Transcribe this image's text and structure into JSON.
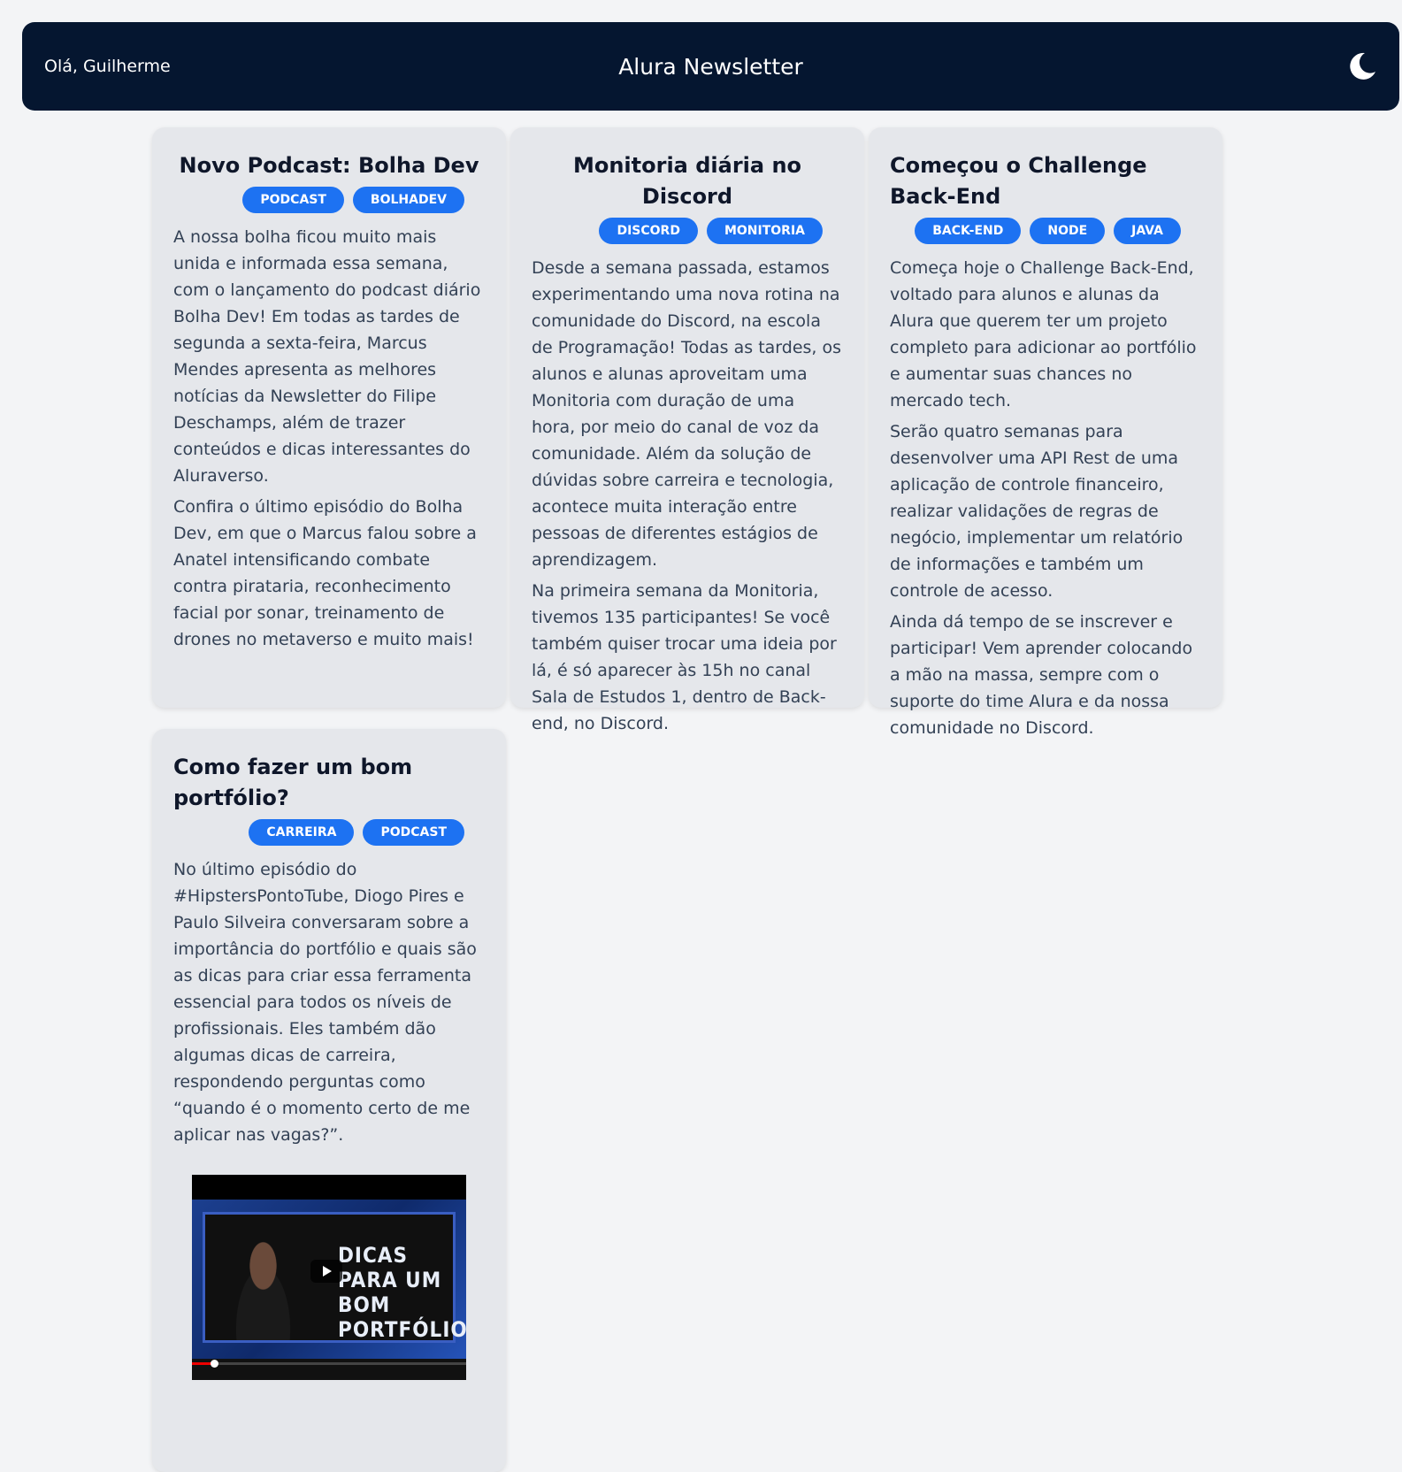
{
  "header": {
    "greeting": "Olá, Guilherme",
    "title": "Alura Newsletter",
    "theme_icon": "moon-icon"
  },
  "posts": [
    {
      "title": "Novo Podcast: Bolha Dev",
      "tags": [
        "PODCAST",
        "BOLHADEV"
      ],
      "paragraphs": [
        "A nossa bolha ficou muito mais unida e informada essa semana, com o lançamento do podcast diário Bolha Dev! Em todas as tardes de segunda a sexta-feira, Marcus Mendes apresenta as melhores notícias da Newsletter do Filipe Deschamps, além de trazer conteúdos e dicas interessantes do Aluraverso.",
        "Confira o último episódio do Bolha Dev, em que o Marcus falou sobre a Anatel intensificando combate contra pirataria, reconhecimento facial por sonar, treinamento de drones no metaverso e muito mais!"
      ]
    },
    {
      "title": "Monitoria diária no Discord",
      "tags": [
        "DISCORD",
        "MONITORIA"
      ],
      "paragraphs": [
        "Desde a semana passada, estamos experimentando uma nova rotina na comunidade do Discord, na escola de Programação! Todas as tardes, os alunos e alunas aproveitam uma Monitoria com duração de uma hora, por meio do canal de voz da comunidade. Além da solução de dúvidas sobre carreira e tecnologia, acontece muita interação entre pessoas de diferentes estágios de aprendizagem.",
        "Na primeira semana da Monitoria, tivemos 135 participantes! Se você também quiser trocar uma ideia por lá, é só aparecer às 15h no canal Sala de Estudos 1, dentro de Back-end, no Discord."
      ]
    },
    {
      "title": "Começou o Challenge Back-End",
      "tags": [
        "BACK-END",
        "NODE",
        "JAVA"
      ],
      "paragraphs": [
        "Começa hoje o Challenge Back-End, voltado para alunos e alunas da Alura que querem ter um projeto completo para adicionar ao portfólio e aumentar suas chances no mercado tech.",
        "Serão quatro semanas para desenvolver uma API Rest de uma aplicação de controle financeiro, realizar validações de regras de negócio, implementar um relatório de informações e também um controle de acesso.",
        "Ainda dá tempo de se inscrever e participar! Vem aprender colocando a mão na massa, sempre com o suporte do time Alura e da nossa comunidade no Discord."
      ]
    },
    {
      "title": "Como fazer um bom portfólio?",
      "tags": [
        "CARREIRA",
        "PODCAST"
      ],
      "paragraphs": [
        "No último episódio do #HipstersPontoTube, Diogo Pires e Paulo Silveira conversaram sobre a importância do portfólio e quais são as dicas para criar essa ferramenta essencial para todos os níveis de profissionais. Eles também dão algumas dicas de carreira, respondendo perguntas como “quando é o momento certo de me aplicar nas vagas?”."
      ],
      "video": {
        "thumbnail_text": "DICAS PARA UM BOM PORTFÓLIO",
        "play_icon": "play-icon",
        "progress": 0.08
      }
    }
  ],
  "colors": {
    "header_bg": "#051630",
    "tag_bg": "#1d72f2",
    "card_bg": "#e5e7eb",
    "page_bg": "#f3f4f6"
  }
}
